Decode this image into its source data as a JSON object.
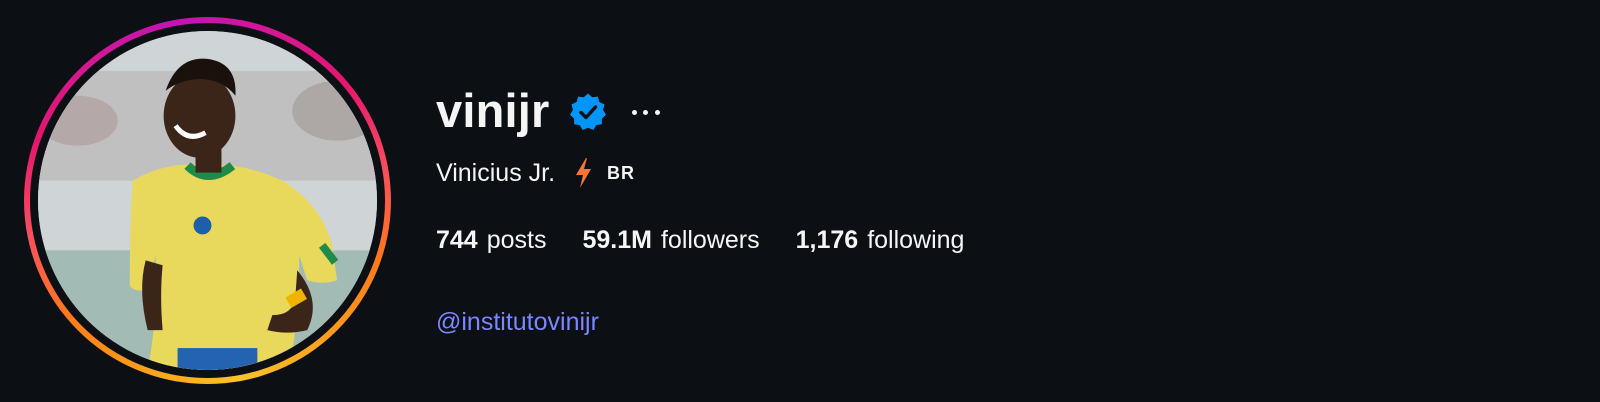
{
  "profile": {
    "username": "vinijr",
    "full_name": "Vinicius Jr.",
    "country_code": "BR",
    "verified_icon": "verified-badge-icon",
    "more_icon": "more-options-icon",
    "name_icon": "lightning-bolt-icon"
  },
  "stats": [
    {
      "number": "744",
      "label": "posts"
    },
    {
      "number": "59.1M",
      "label": "followers"
    },
    {
      "number": "1,176",
      "label": "following"
    }
  ],
  "bio": {
    "link": "@institutovinijr"
  },
  "colors": {
    "background": "#0c0f14",
    "text": "#f5f5f5",
    "verified": "#0095f6",
    "link": "#7b86ff",
    "bolt": "#f5743a",
    "ring_start": "#fcc22d",
    "ring_mid": "#e6156f",
    "ring_end": "#c213b6"
  }
}
